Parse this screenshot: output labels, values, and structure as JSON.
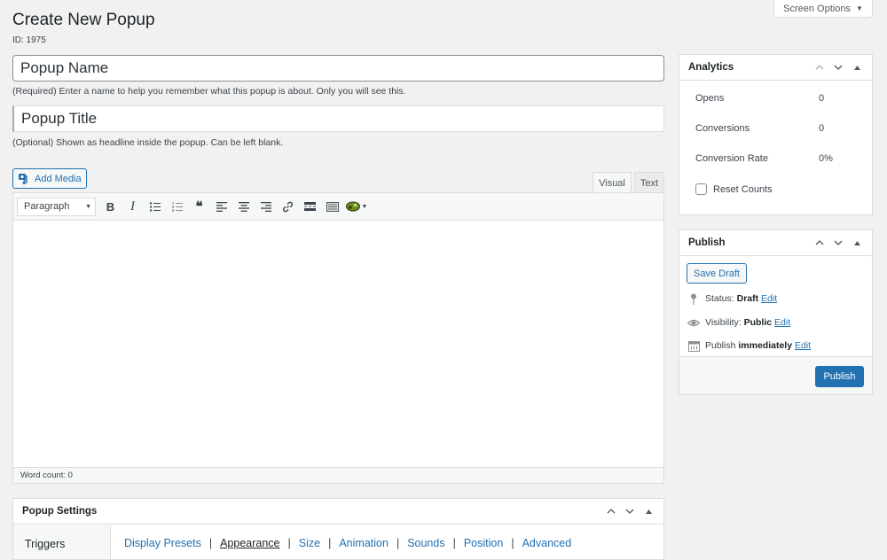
{
  "screen_options": {
    "label": "Screen Options"
  },
  "header": {
    "title": "Create New Popup",
    "id_label": "ID: 1975"
  },
  "fields": {
    "name": {
      "value": "Popup Name",
      "help": "(Required) Enter a name to help you remember what this popup is about. Only you will see this."
    },
    "title": {
      "value": "Popup Title",
      "help": "(Optional) Shown as headline inside the popup. Can be left blank."
    }
  },
  "editor": {
    "add_media_label": "Add Media",
    "tabs": [
      {
        "label": "Visual",
        "active": true
      },
      {
        "label": "Text",
        "active": false
      }
    ],
    "format_select": "Paragraph",
    "toolbar_icons": [
      "bold-icon",
      "italic-icon",
      "bulleted-list-icon",
      "numbered-list-icon",
      "blockquote-icon",
      "align-left-icon",
      "align-center-icon",
      "align-right-icon",
      "link-icon",
      "read-more-icon",
      "toolbar-toggle-icon",
      "custom-plugin-icon"
    ],
    "word_count": "Word count: 0"
  },
  "analytics": {
    "title": "Analytics",
    "rows": [
      {
        "label": "Opens",
        "value": "0"
      },
      {
        "label": "Conversions",
        "value": "0"
      },
      {
        "label": "Conversion Rate",
        "value": "0%"
      }
    ],
    "reset_label": "Reset Counts"
  },
  "publish": {
    "title": "Publish",
    "save_draft_label": "Save Draft",
    "status_label": "Status:",
    "status_value": "Draft",
    "visibility_label": "Visibility:",
    "visibility_value": "Public",
    "schedule_label": "Publish",
    "schedule_value": "immediately",
    "edit_label": "Edit",
    "publish_label": "Publish"
  },
  "popup_settings": {
    "title": "Popup Settings",
    "nav": [
      "Triggers"
    ],
    "subnav": [
      {
        "label": "Display Presets",
        "current": false
      },
      {
        "label": "Appearance",
        "current": true
      },
      {
        "label": "Size",
        "current": false
      },
      {
        "label": "Animation",
        "current": false
      },
      {
        "label": "Sounds",
        "current": false
      },
      {
        "label": "Position",
        "current": false
      },
      {
        "label": "Advanced",
        "current": false
      }
    ],
    "separator": "|"
  },
  "colors": {
    "accent": "#2271b1",
    "background": "#f1f1f1",
    "border": "#dcdcde"
  }
}
